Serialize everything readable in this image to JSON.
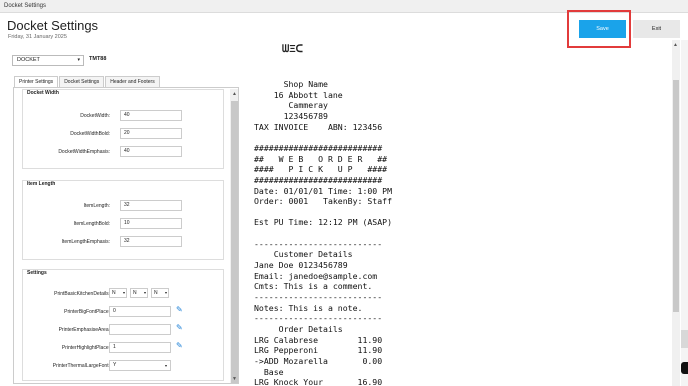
{
  "window": {
    "title": "Docket Settings"
  },
  "header": {
    "title": "Docket Settings",
    "date": "Friday, 31 January 2025",
    "save_label": "Save",
    "exit_label": "Exit"
  },
  "docket_select": {
    "value": "DOCKET"
  },
  "printer_name": "TMT88",
  "tabs": [
    {
      "label": "Printer Settings",
      "active": true
    },
    {
      "label": "Docket Settings",
      "active": false
    },
    {
      "label": "Header and Footers",
      "active": false
    }
  ],
  "docket_width_group": {
    "label": "Docket Width",
    "fields": [
      {
        "label": "DocketWidth:",
        "value": "40"
      },
      {
        "label": "DocketWidthBold:",
        "value": "20"
      },
      {
        "label": "DocketWidthEmphasis:",
        "value": "40"
      }
    ]
  },
  "item_length_group": {
    "label": "Item Length",
    "fields": [
      {
        "label": "ItemLength:",
        "value": "32"
      },
      {
        "label": "ItemLengthBold:",
        "value": "10"
      },
      {
        "label": "ItemLengthEmphasis:",
        "value": "32"
      }
    ]
  },
  "settings_group": {
    "label": "Settings",
    "print_basic_kitchen_details": {
      "label": "PrintBasicKitchenDetails:",
      "values": [
        "N",
        "N",
        "N"
      ]
    },
    "printer_big_font_place": {
      "label": "PrinterBigFontPlace:",
      "value": "0"
    },
    "printer_emphasise_area": {
      "label": "PrinterEmphasiseArea:",
      "value": ""
    },
    "printer_highlight_place": {
      "label": "PrinterHighlightPlace:",
      "value": "1"
    },
    "printer_thermal_large_font": {
      "label": "PrinterThermalLargeFont:",
      "value": "Y"
    }
  },
  "receipt": {
    "logo_text": "ᗯΞᑕ",
    "lines": [
      "      Shop Name",
      "    16 Abbott lane",
      "       Cammeray",
      "      123456789",
      "TAX INVOICE    ABN: 123456",
      "",
      "##########################",
      "##   W E B   O R D E R   ##",
      "####   P I C K   U P   ####",
      "##########################",
      "Date: 01/01/01 Time: 1:00 PM",
      "Order: 0001   TakenBy: Staff",
      "",
      "Est PU Time: 12:12 PM (ASAP)",
      "",
      "--------------------------",
      "    Customer Details",
      "Jane Doe 0123456789",
      "Email: janedoe@sample.com",
      "Cmts: This is a comment.",
      "--------------------------",
      "Notes: This is a note.",
      "--------------------------",
      "     Order Details",
      "LRG Calabrese        11.90",
      "LRG Pepperoni        11.90",
      "->ADD Mozarella       0.00",
      "  Base",
      "LRG Knock Your       16.90"
    ]
  }
}
